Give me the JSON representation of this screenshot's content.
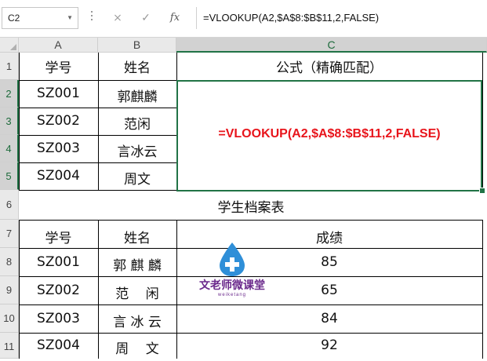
{
  "formula_bar": {
    "name_box": "C2",
    "cancel_icon": "×",
    "confirm_icon": "✓",
    "fx_icon": "fx",
    "formula": "=VLOOKUP(A2,$A$8:$B$11,2,FALSE)"
  },
  "columns": [
    "A",
    "B",
    "C"
  ],
  "rows": [
    "1",
    "2",
    "3",
    "4",
    "5",
    "6",
    "7",
    "8",
    "9",
    "10",
    "11"
  ],
  "top_table": {
    "header": [
      "学号",
      "姓名",
      "公式（精确匹配）"
    ],
    "ids": [
      "SZ001",
      "SZ002",
      "SZ003",
      "SZ004"
    ],
    "names": [
      "郭麒麟",
      "范闲",
      "言冰云",
      "周文"
    ],
    "formula_display": "=VLOOKUP(A2,$A$8:$B$11,2,FALSE)"
  },
  "archive_title": "学生档案表",
  "archive_table": {
    "header": [
      "学号",
      "姓名",
      "成绩"
    ],
    "ids": [
      "SZ001",
      "SZ002",
      "SZ003",
      "SZ004"
    ],
    "names": [
      "郭 麒 麟",
      "范    闲",
      "言 冰 云",
      "周    文"
    ],
    "scores": [
      "85",
      "65",
      "84",
      "92"
    ]
  },
  "watermark": {
    "title": "文老师微课堂",
    "subtitle": "weiketang",
    "color": "#6b2a8c",
    "drop_color": "#2f8fd8"
  },
  "colors": {
    "selection": "#217346",
    "formula_text": "#e8141b"
  }
}
